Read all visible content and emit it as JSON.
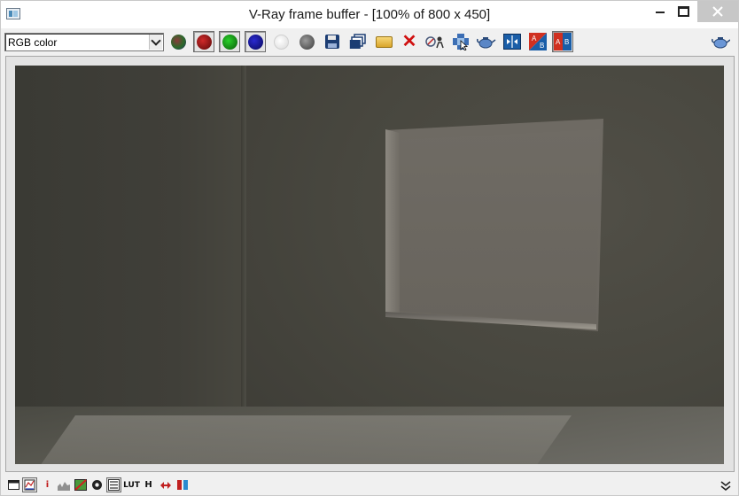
{
  "window": {
    "title": "V-Ray frame buffer - [100% of 800 x 450]",
    "close_color": "#c7c7c7"
  },
  "toolbar": {
    "channel_select": {
      "value": "RGB color"
    },
    "buttons": [
      {
        "name": "rgb-channel-icon",
        "color": "#808080",
        "pressed": false
      },
      {
        "name": "red-channel-icon",
        "color": "#c01818",
        "pressed": true
      },
      {
        "name": "green-channel-icon",
        "color": "#18a018",
        "pressed": true
      },
      {
        "name": "blue-channel-icon",
        "color": "#1818b0",
        "pressed": true
      },
      {
        "name": "alpha-channel-icon",
        "color": "#ffffff",
        "pressed": false
      },
      {
        "name": "monochrome-icon",
        "color": "#707070",
        "pressed": false
      },
      {
        "name": "save-image-icon",
        "pressed": false
      },
      {
        "name": "duplicate-frame-buffer-icon",
        "pressed": false
      },
      {
        "name": "load-image-icon",
        "pressed": false
      },
      {
        "name": "clear-image-icon",
        "pressed": false
      },
      {
        "name": "track-mouse-icon",
        "pressed": false
      },
      {
        "name": "region-render-icon",
        "pressed": false
      },
      {
        "name": "render-last-icon",
        "pressed": false
      },
      {
        "name": "ab-compare-horizontal-icon",
        "pressed": false
      },
      {
        "name": "ab-compare-vertical-icon",
        "pressed": false
      },
      {
        "name": "ab-history-icon",
        "pressed": true
      },
      {
        "name": "render-teapot-icon",
        "pressed": false
      }
    ]
  },
  "statusbar": {
    "info_label": "i",
    "lut_label": "LUT",
    "hue_label": "H"
  }
}
